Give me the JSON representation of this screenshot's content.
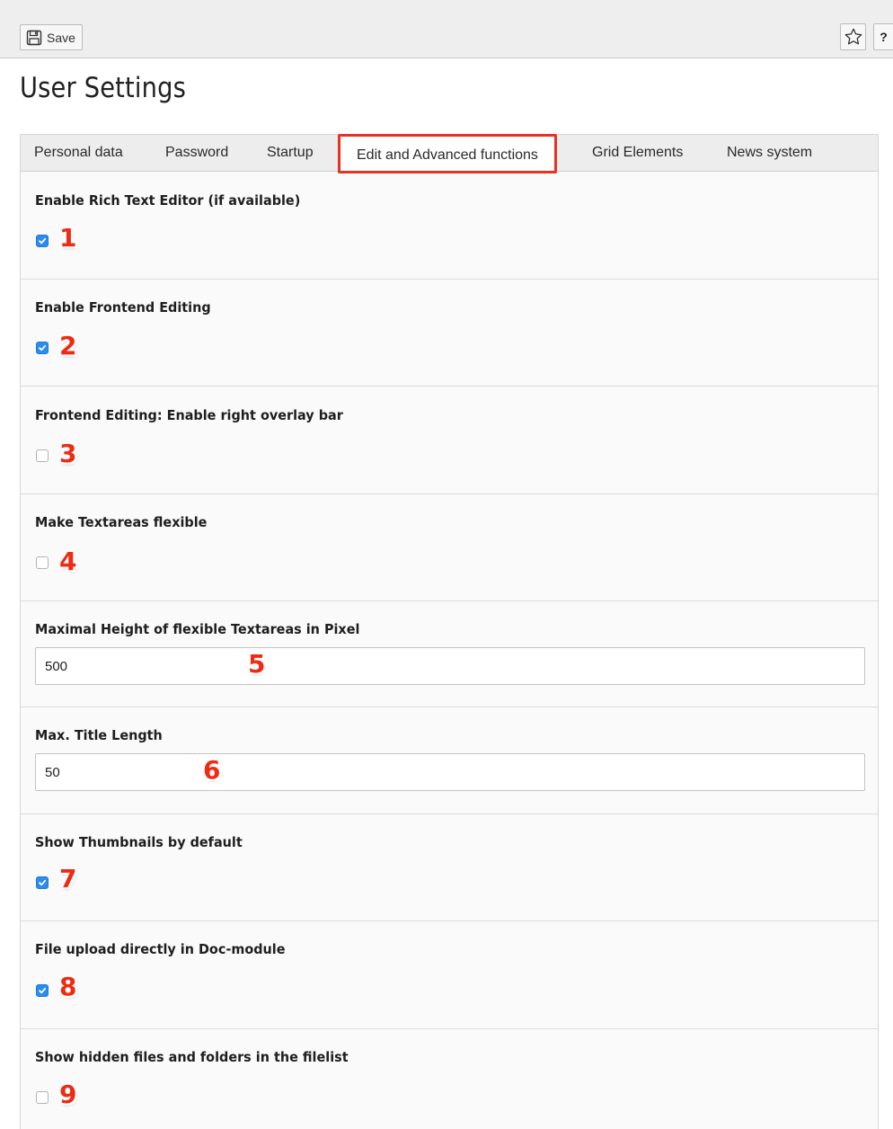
{
  "toolbar": {
    "save_label": "Save",
    "help_label": "?"
  },
  "page": {
    "title": "User Settings"
  },
  "tabs": [
    {
      "label": "Personal data",
      "active": false
    },
    {
      "label": "Password",
      "active": false
    },
    {
      "label": "Startup",
      "active": false
    },
    {
      "label": "Edit and Advanced functions",
      "active": true
    },
    {
      "label": "Grid Elements",
      "active": false
    },
    {
      "label": "News system",
      "active": false
    }
  ],
  "settings": [
    {
      "label": "Enable Rich Text Editor (if available)",
      "type": "checkbox",
      "checked": true,
      "marker": "1"
    },
    {
      "label": "Enable Frontend Editing",
      "type": "checkbox",
      "checked": true,
      "marker": "2"
    },
    {
      "label": "Frontend Editing: Enable right overlay bar",
      "type": "checkbox",
      "checked": false,
      "marker": "3"
    },
    {
      "label": "Make Textareas flexible",
      "type": "checkbox",
      "checked": false,
      "marker": "4"
    },
    {
      "label": "Maximal Height of flexible Textareas in Pixel",
      "type": "text",
      "value": "500",
      "marker": "5"
    },
    {
      "label": "Max. Title Length",
      "type": "text",
      "value": "50",
      "marker": "6"
    },
    {
      "label": "Show Thumbnails by default",
      "type": "checkbox",
      "checked": true,
      "marker": "7"
    },
    {
      "label": "File upload directly in Doc-module",
      "type": "checkbox",
      "checked": true,
      "marker": "8"
    },
    {
      "label": "Show hidden files and folders in the filelist",
      "type": "checkbox",
      "checked": false,
      "marker": "9"
    }
  ],
  "colors": {
    "accent_highlight": "#e8321f",
    "checkbox_checked": "#2a8cf0",
    "marker_number": "#ee2b14"
  },
  "icons": {
    "save": "floppy-disk-icon",
    "bookmark": "star-outline-icon",
    "check": "checkmark-icon"
  }
}
